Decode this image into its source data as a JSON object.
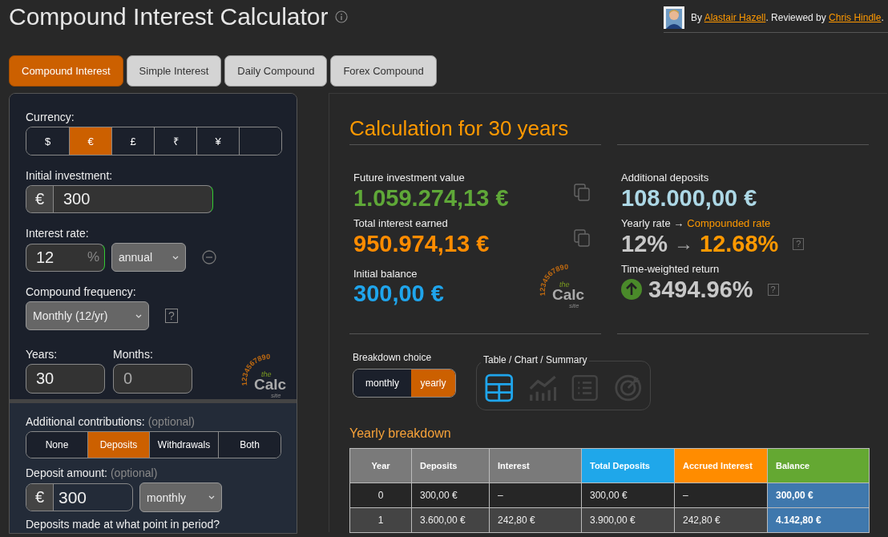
{
  "header": {
    "title": "Compound Interest Calculator",
    "byline": [
      {
        "kind": "text",
        "text": "By "
      },
      {
        "kind": "link",
        "text": "Alastair Hazell"
      },
      {
        "kind": "text",
        "text": ". Reviewed by "
      },
      {
        "kind": "link",
        "text": "Chris Hindle"
      },
      {
        "kind": "text",
        "text": "."
      }
    ]
  },
  "tabs": [
    {
      "label": "Compound Interest",
      "selected": true
    },
    {
      "label": "Simple Interest",
      "selected": false
    },
    {
      "label": "Daily Compound",
      "selected": false
    },
    {
      "label": "Forex Compound",
      "selected": false
    }
  ],
  "inputs": {
    "currency": {
      "label": "Currency:",
      "options": [
        {
          "kind": "symbol",
          "label": "$",
          "selected": false
        },
        {
          "kind": "symbol",
          "label": "€",
          "selected": true
        },
        {
          "kind": "symbol",
          "label": "£",
          "selected": false
        },
        {
          "kind": "symbol",
          "label": "₹",
          "selected": false
        },
        {
          "kind": "symbol",
          "label": "¥",
          "selected": false
        },
        {
          "kind": "blank",
          "selected": false
        }
      ]
    },
    "initial": {
      "label": "Initial investment:",
      "symbol": "€",
      "value": "300"
    },
    "rate": {
      "label": "Interest rate:",
      "value": "12",
      "unit": "%",
      "period": "annual"
    },
    "frequency": {
      "label": "Compound frequency:",
      "value": "Monthly (12/yr)",
      "help": "?"
    },
    "years": {
      "label": "Years:",
      "value": "30"
    },
    "months": {
      "label": "Months:",
      "value": "0"
    },
    "logo": {
      "digits": "1234567890",
      "the": "the",
      "name": "Calc",
      "site": "site"
    },
    "contributions": {
      "label": "Additional contributions:",
      "hint": "(optional)",
      "options": [
        {
          "label": "None",
          "selected": false
        },
        {
          "label": "Deposits",
          "selected": true
        },
        {
          "label": "Withdrawals",
          "selected": false
        },
        {
          "label": "Both",
          "selected": false
        }
      ]
    },
    "deposit": {
      "label": "Deposit amount:",
      "hint": "(optional)",
      "symbol": "€",
      "value": "300",
      "period": "monthly"
    },
    "timing_question": "Deposits made at what point in period?"
  },
  "results": {
    "title": "Calculation for 30 years",
    "left": [
      {
        "kind": "copy",
        "label": "Future investment value",
        "value": "1.059.274,13 €",
        "color": "#5fa838"
      },
      {
        "kind": "copy",
        "label": "Total interest earned",
        "value": "950.974,13 €",
        "color": "#ff8c00"
      },
      {
        "kind": "logo",
        "label": "Initial balance",
        "value": "300,00 €",
        "color": "#1fa5ec",
        "logo": {
          "digits": "1234567890",
          "the": "the",
          "name": "Calc",
          "site": "site"
        }
      }
    ],
    "right": [
      {
        "kind": "plain",
        "label": "Additional deposits",
        "value": "108.000,00 €",
        "color": "#add8e6"
      },
      {
        "kind": "rate",
        "label": "Yearly rate →",
        "label_accent": "Compounded rate",
        "value": "12%",
        "arrow": "→",
        "value_accent": "12.68%",
        "help": "?",
        "color": "#c8c8c8"
      },
      {
        "kind": "up",
        "label": "Time-weighted return",
        "value": "3494.96%",
        "help": "?",
        "color": "#c8c8c8"
      }
    ],
    "breakdown": {
      "label": "Breakdown choice",
      "options": [
        {
          "label": "monthly",
          "selected": false
        },
        {
          "label": "yearly",
          "selected": true
        }
      ]
    },
    "views": {
      "label": "Table / Chart / Summary",
      "options": [
        {
          "kind": "table",
          "selected": true
        },
        {
          "kind": "chart",
          "selected": false
        },
        {
          "kind": "list",
          "selected": false
        },
        {
          "kind": "target",
          "selected": false
        }
      ]
    },
    "table": {
      "title": "Yearly breakdown",
      "columns": [
        {
          "label": "Year",
          "color": "#7a7a7a"
        },
        {
          "label": "Deposits",
          "color": "#7a7a7a"
        },
        {
          "label": "Interest",
          "color": "#7a7a7a"
        },
        {
          "label": "Total Deposits",
          "color": "#1fa7ea"
        },
        {
          "label": "Accrued Interest",
          "color": "#ff8c00"
        },
        {
          "label": "Balance",
          "color": "#64a832"
        }
      ],
      "rows": [
        [
          "0",
          "300,00 €",
          "–",
          "300,00 €",
          "–",
          "300,00 €"
        ],
        [
          "1",
          "3.600,00 €",
          "242,80 €",
          "3.900,00 €",
          "242,80 €",
          "4.142,80 €"
        ]
      ]
    }
  }
}
